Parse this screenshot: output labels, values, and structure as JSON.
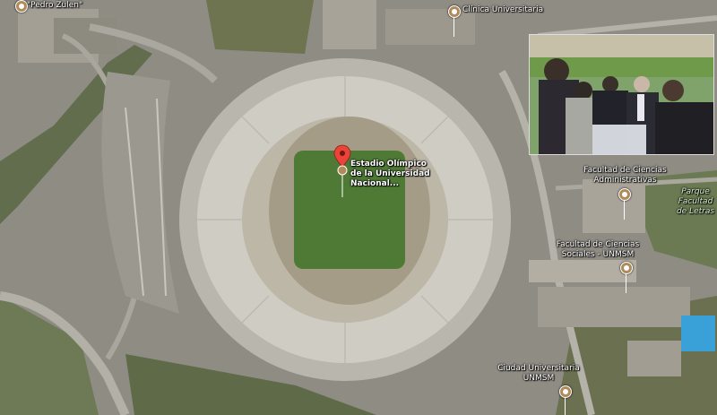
{
  "places": {
    "stadium": "Estadio Olímpico de la Universidad Nacional...",
    "pedro_zulen": "\"Pedro Zulen\"",
    "clinica": "Clínica Universitaria",
    "fac_admin": "Facultad de Ciencias Administrativas",
    "fac_social": "Facultad de Ciencias Sociales - UNMSM",
    "parque": "Parque Facultad de Letras",
    "ciudad_univ": "Ciudad Universitaria UNMSM"
  },
  "colors": {
    "marker": "#e8443a",
    "pin": "#b08a5a",
    "pitch": "#4f7a35"
  },
  "icons": {
    "stadium_marker": "red-map-pin-icon",
    "poi": "place-pin-icon"
  }
}
